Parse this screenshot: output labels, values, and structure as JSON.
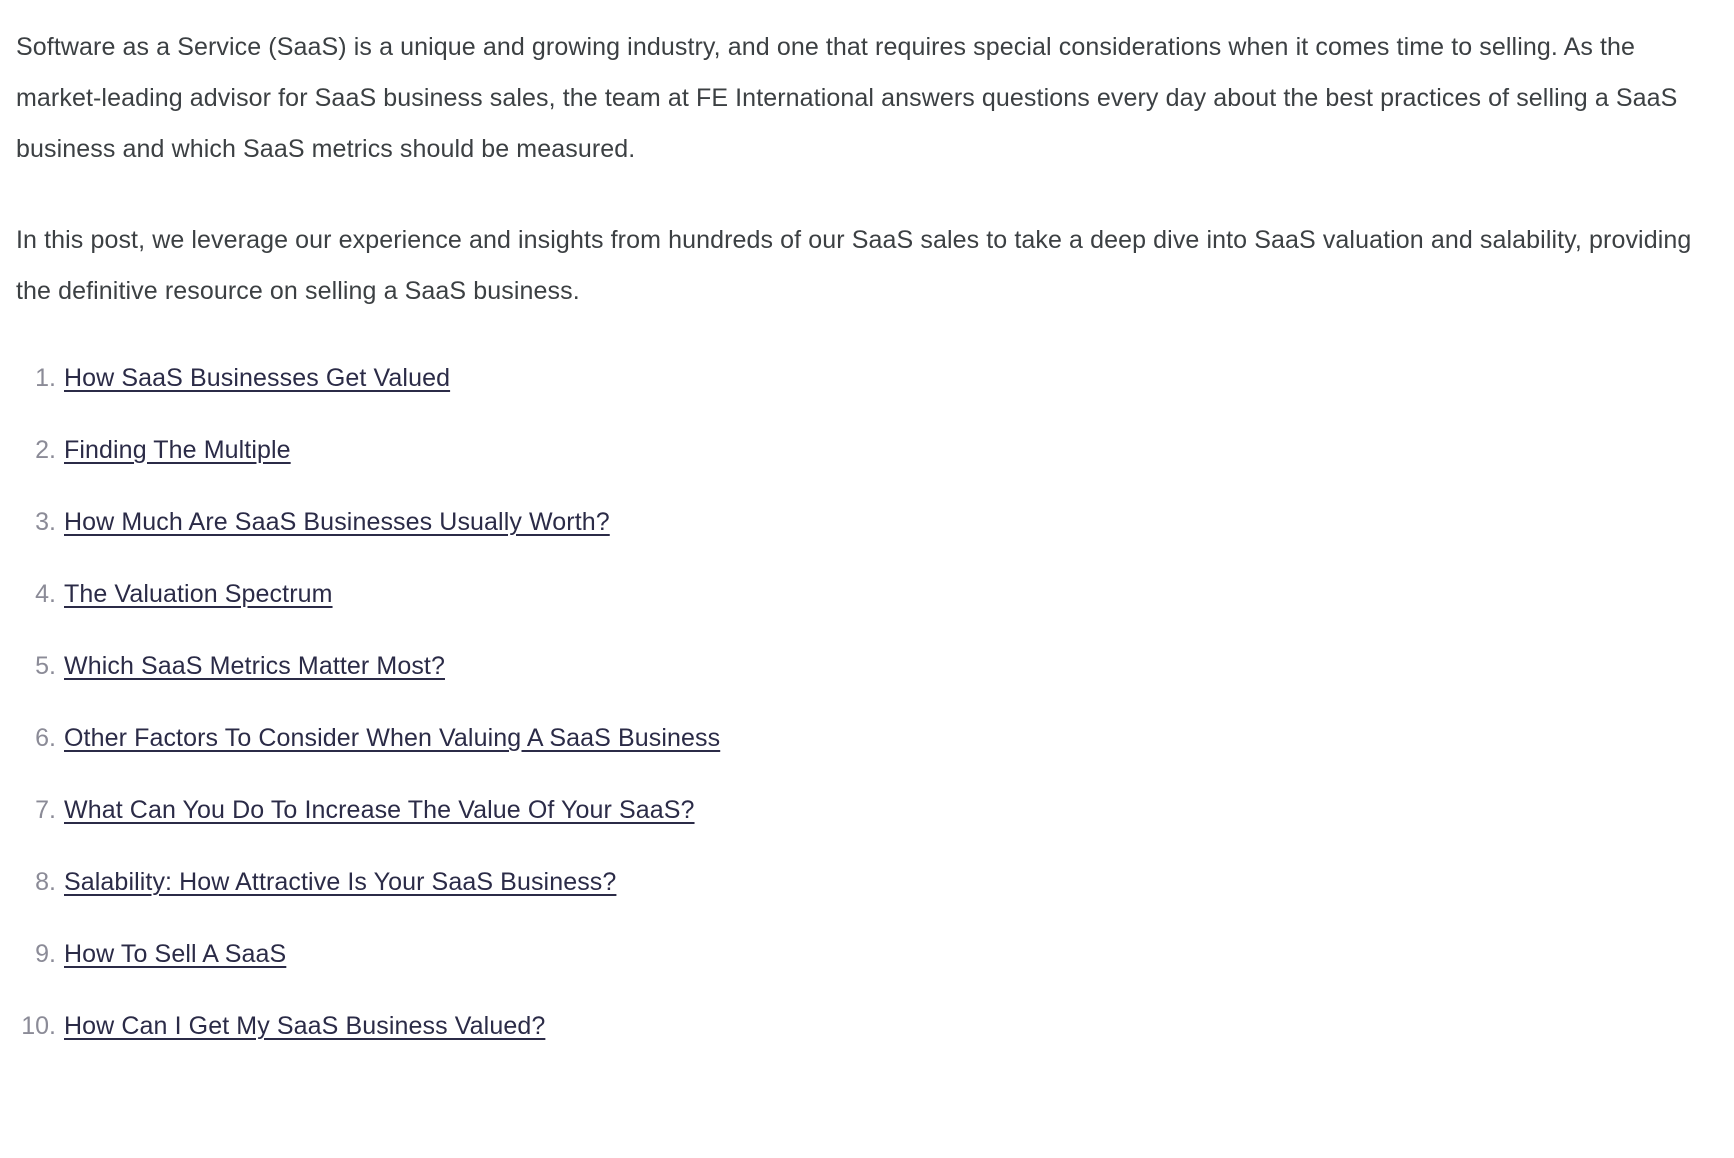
{
  "article": {
    "paragraphs": [
      "Software as a Service (SaaS) is a unique and growing industry, and one that requires special considerations when it comes time to selling. As the market-leading advisor for SaaS business sales, the team at FE International answers questions every day about the best practices of selling a SaaS business and which SaaS metrics should be measured.",
      "In this post, we leverage our experience and insights from hundreds of our SaaS sales to take a deep dive into SaaS valuation and salability, providing the definitive resource on selling a SaaS business."
    ],
    "toc": {
      "items": [
        {
          "number": "1.",
          "label": "How SaaS Businesses Get Valued"
        },
        {
          "number": "2.",
          "label": "Finding The Multiple"
        },
        {
          "number": "3.",
          "label": "How Much Are SaaS Businesses Usually Worth?"
        },
        {
          "number": "4.",
          "label": "The Valuation Spectrum"
        },
        {
          "number": "5.",
          "label": "Which SaaS Metrics Matter Most?"
        },
        {
          "number": "6.",
          "label": "Other Factors To Consider When Valuing A SaaS Business"
        },
        {
          "number": "7.",
          "label": "What Can You Do To Increase The Value Of Your SaaS?"
        },
        {
          "number": "8.",
          "label": "Salability: How Attractive Is Your SaaS Business?"
        },
        {
          "number": "9.",
          "label": "How To Sell A SaaS"
        },
        {
          "number": "10.",
          "label": "How Can I Get My SaaS Business Valued?"
        }
      ]
    },
    "colors": {
      "body_text": "#3c4043",
      "link_text": "#2b2b47",
      "marker_text": "#8b8b97",
      "background": "#ffffff"
    }
  }
}
